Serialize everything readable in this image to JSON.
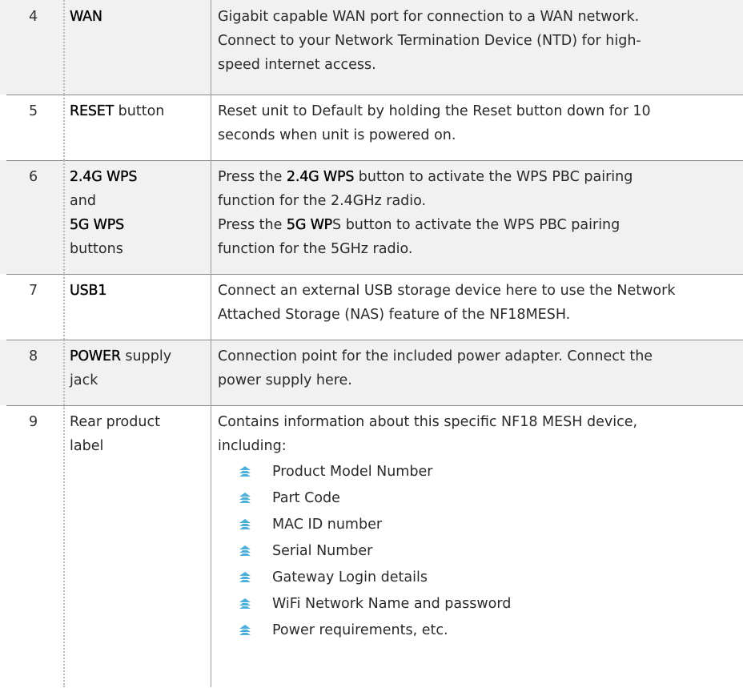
{
  "colors": {
    "row_shade": "#f1f1f1",
    "rule": "#8a8a8a",
    "bullet": "#3aa6d6"
  },
  "rows": [
    {
      "num": "4",
      "name_parts": [
        {
          "text": "WAN",
          "bold": true
        }
      ],
      "desc_lines": [
        "Gigabit capable WAN port for connection to a WAN network.",
        "Connect to your Network Termination Device (NTD) for high-",
        "speed internet access."
      ]
    },
    {
      "num": "5",
      "name_bold": "RESET",
      "name_rest": " button",
      "desc_lines": [
        "Reset unit to Default by holding the Reset button down for 10",
        "seconds when unit is powered on."
      ]
    },
    {
      "num": "6",
      "name_line1": "2.4G WPS",
      "name_line2": "and",
      "name_line3": "5G WPS",
      "name_line4": "buttons",
      "desc_a_pre": "Press the ",
      "desc_a_bold": "2.4G WPS",
      "desc_a_post": " button to activate the WPS PBC pairing",
      "desc_b": "function for the 2.4GHz radio.",
      "desc_c_pre": "Press the ",
      "desc_c_bold": "5G WP",
      "desc_c_post": "S button to activate the WPS PBC pairing",
      "desc_d": "function for the 5GHz radio."
    },
    {
      "num": "7",
      "name_bold": "USB1",
      "desc_lines": [
        "Connect an external USB storage device here to use the Network",
        "Attached Storage (NAS) feature of the NF18MESH."
      ]
    },
    {
      "num": "8",
      "name_bold": "POWER",
      "name_rest": " supply",
      "name_line2": "jack",
      "desc_lines": [
        "Connection point for the included power adapter. Connect the",
        "power supply here."
      ]
    },
    {
      "num": "9",
      "name_line1": "Rear product",
      "name_line2": "label",
      "desc_lines": [
        "Contains information about this specific NF18 MESH device,",
        "including:"
      ],
      "bullets": [
        "Product Model Number",
        "Part Code",
        "MAC ID number",
        "Serial Number",
        "Gateway Login details",
        "WiFi Network Name and password",
        "Power requirements, etc."
      ]
    }
  ]
}
